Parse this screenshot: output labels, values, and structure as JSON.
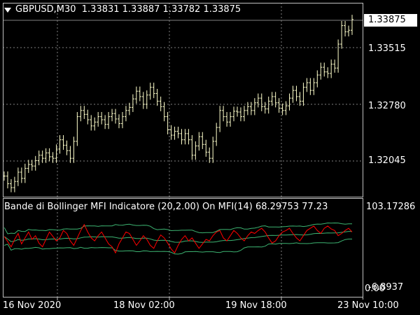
{
  "header": {
    "symbol": "GBPUSD,M30",
    "ohlc": "1.33831 1.33887 1.33782 1.33875"
  },
  "price_axis": {
    "current_price": "1.33875",
    "ticks": [
      "1.33515",
      "1.32780",
      "1.32045"
    ]
  },
  "indicator": {
    "title": "Bande di Bollinger MFI Indicatore (20,2.00) On MFI(14) 68.29753 77.23",
    "axis_top": "103.17286",
    "axis_bottom": "-6.8937",
    "axis_zero": "0.00"
  },
  "time_axis": {
    "ticks": [
      "16 Nov 2020",
      "18 Nov 02:00",
      "19 Nov 18:00",
      "23 Nov 10:00"
    ]
  },
  "colors": {
    "background": "#000000",
    "bars": "#FFFFCC",
    "mfi": "#FF0000",
    "bands": "#3CB371",
    "grid": "#808080"
  },
  "chart_data": {
    "type": "ohlc",
    "price_close": [
      1.3185,
      1.3175,
      1.317,
      1.3178,
      1.319,
      1.3182,
      1.3195,
      1.32,
      1.3198,
      1.3205,
      1.3212,
      1.3208,
      1.3215,
      1.321,
      1.3208,
      1.322,
      1.3232,
      1.3225,
      1.3218,
      1.3208,
      1.323,
      1.3262,
      1.327,
      1.3265,
      1.3258,
      1.325,
      1.3255,
      1.3262,
      1.3258,
      1.3252,
      1.3262,
      1.3266,
      1.3259,
      1.3253,
      1.3262,
      1.327,
      1.3274,
      1.3285,
      1.3295,
      1.3288,
      1.3278,
      1.329,
      1.33,
      1.3292,
      1.3282,
      1.3275,
      1.3262,
      1.3245,
      1.3238,
      1.3243,
      1.324,
      1.3232,
      1.324,
      1.3232,
      1.3212,
      1.3224,
      1.3236,
      1.3226,
      1.3216,
      1.3208,
      1.323,
      1.3248,
      1.327,
      1.3262,
      1.3255,
      1.3262,
      1.3269,
      1.3268,
      1.3262,
      1.327,
      1.3275,
      1.327,
      1.328,
      1.3286,
      1.3275,
      1.3272,
      1.3282,
      1.3288,
      1.328,
      1.3273,
      1.327,
      1.3276,
      1.3286,
      1.3296,
      1.3288,
      1.3282,
      1.33,
      1.3306,
      1.3296,
      1.3306,
      1.3316,
      1.3326,
      1.332,
      1.3318,
      1.333,
      1.3325,
      1.3356,
      1.338,
      1.3372,
      1.3374,
      1.3388
    ],
    "mfi": [
      62,
      55,
      48,
      58,
      66,
      52,
      60,
      68,
      58,
      63,
      53,
      48,
      58,
      68,
      62,
      56,
      60,
      70,
      66,
      56,
      50,
      60,
      70,
      78,
      68,
      60,
      56,
      63,
      68,
      60,
      52,
      48,
      40,
      52,
      60,
      68,
      66,
      58,
      50,
      56,
      63,
      58,
      50,
      46,
      56,
      64,
      60,
      53,
      45,
      40,
      50,
      58,
      63,
      56,
      60,
      53,
      46,
      52,
      58,
      56,
      63,
      68,
      70,
      60,
      56,
      63,
      70,
      66,
      60,
      56,
      63,
      68,
      66,
      70,
      73,
      68,
      60,
      53,
      56,
      63,
      68,
      70,
      73,
      66,
      60,
      56,
      63,
      70,
      73,
      76,
      70,
      66,
      73,
      76,
      72,
      70,
      63,
      66,
      70,
      73,
      68
    ],
    "x_ticks": [
      "16 Nov 2020",
      "18 Nov 02:00",
      "19 Nov 18:00",
      "23 Nov 10:00"
    ],
    "y_ticks": [
      "1.33515",
      "1.32780",
      "1.32045"
    ],
    "grid": true
  }
}
